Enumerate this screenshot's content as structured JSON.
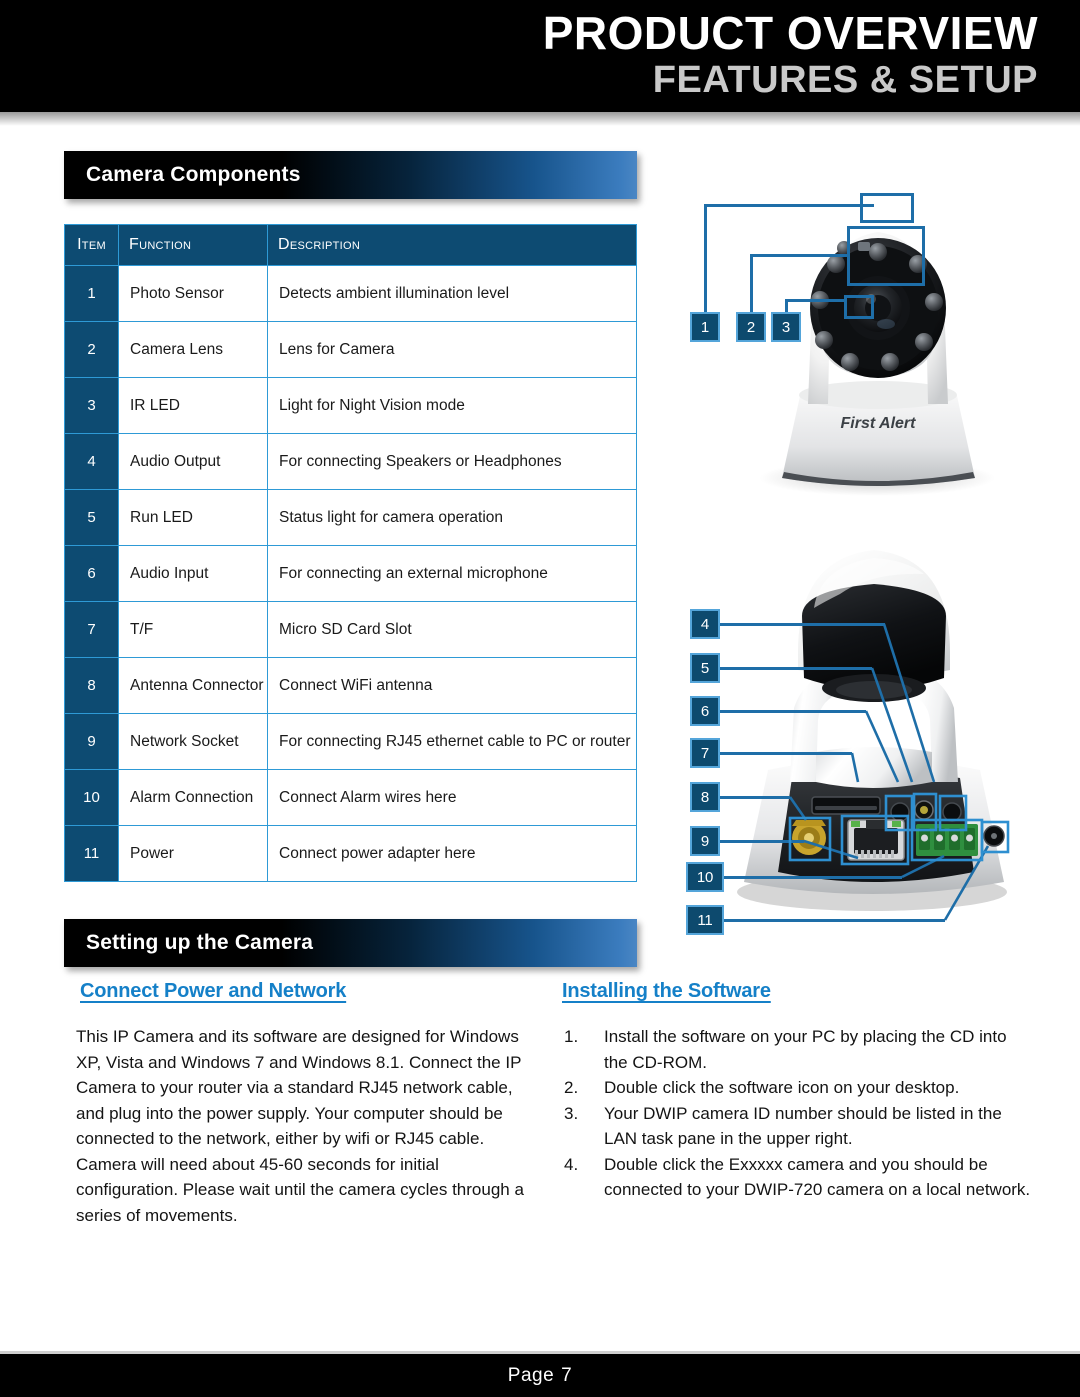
{
  "header": {
    "title_main": "PRODUCT OVERVIEW",
    "title_sub": "FEATURES & SETUP"
  },
  "sections": {
    "camera_components": {
      "banner_label": "Camera Components"
    },
    "setting_up": {
      "banner_label": "Setting up the Camera"
    }
  },
  "components_table": {
    "columns": [
      "Item",
      "Function",
      "Description"
    ],
    "rows": [
      {
        "item": "1",
        "function": "Photo Sensor",
        "description": "Detects ambient illumination level"
      },
      {
        "item": "2",
        "function": "Camera Lens",
        "description": "Lens for Camera"
      },
      {
        "item": "3",
        "function": "IR LED",
        "description": "Light for Night Vision mode"
      },
      {
        "item": "4",
        "function": "Audio Output",
        "description": "For connecting Speakers or Headphones"
      },
      {
        "item": "5",
        "function": "Run LED",
        "description": "Status light for camera operation"
      },
      {
        "item": "6",
        "function": "Audio Input",
        "description": "For connecting an external microphone"
      },
      {
        "item": "7",
        "function": "T/F",
        "description": "Micro SD Card Slot"
      },
      {
        "item": "8",
        "function": "Antenna Connector",
        "description": "Connect WiFi antenna"
      },
      {
        "item": "9",
        "function": "Network Socket",
        "description": "For connecting RJ45 ethernet cable to PC or router"
      },
      {
        "item": "10",
        "function": "Alarm Connection",
        "description": "Connect Alarm wires here"
      },
      {
        "item": "11",
        "function": "Power",
        "description": "Connect power adapter here"
      }
    ]
  },
  "figures": {
    "camera_front": {
      "brand_label": "First Alert",
      "callouts": [
        "1",
        "2",
        "3"
      ]
    },
    "camera_rear": {
      "callouts": [
        "4",
        "5",
        "6",
        "7",
        "8",
        "9",
        "10",
        "11"
      ]
    }
  },
  "setup": {
    "connect_power": {
      "heading": "Connect Power and Network",
      "paragraphs": [
        "This IP Camera and its software are designed for Windows XP, Vista and Windows 7 and Windows 8.1. Connect the IP Camera to your router via a standard RJ45 network cable, and plug into the power supply. Your computer should be connected to the network, either by wifi or RJ45 cable.",
        "Camera will need about 45-60 seconds for initial configuration. Please wait until the camera cycles through a series of movements."
      ]
    },
    "installing_software": {
      "heading": "Installing the Software",
      "steps": [
        {
          "num": "1.",
          "text": "Install the software on your PC by placing the CD into the CD-ROM."
        },
        {
          "num": "2.",
          "text": "Double click the software icon on your desktop."
        },
        {
          "num": "3.",
          "text": "Your DWIP camera ID number should be listed in the LAN task pane in the upper right."
        },
        {
          "num": "4.",
          "text": "Double click the Exxxxx camera and you should be connected to your DWIP-720 camera on a local network."
        }
      ]
    }
  },
  "footer": {
    "page_label": "Page",
    "page_number": "7"
  },
  "colors": {
    "banner_blue": "#3b7cbe",
    "table_header_blue": "#0d4b72",
    "table_border_blue": "#2e9ad6",
    "callout_fill": "#0d4a6e",
    "callout_border": "#54a5da",
    "heading_blue": "#1580c8",
    "header_black": "#000000",
    "header_sub_gray": "#c9c9c9"
  }
}
